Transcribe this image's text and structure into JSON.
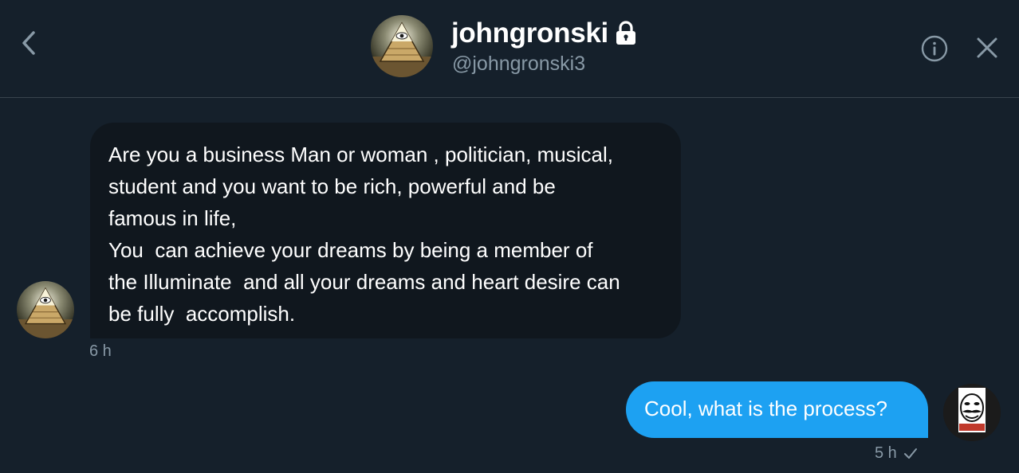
{
  "header": {
    "display_name": "johngronski",
    "handle": "@johngronski3",
    "icons": {
      "back": "chevron-left-icon",
      "lock": "lock-icon",
      "info": "info-icon",
      "close": "close-icon"
    }
  },
  "messages": [
    {
      "from": "them",
      "text": "Are you a business Man or woman , politician, musical,\nstudent and you want to be rich, powerful and be\nfamous in life,\nYou  can achieve your dreams by being a member of\nthe Illuminate  and all your dreams and heart desire can\nbe fully  accomplish.",
      "time": "6 h"
    },
    {
      "from": "me",
      "text": "Cool, what is the process?",
      "time": "5 h",
      "status_icon": "checkmark-icon"
    }
  ],
  "colors": {
    "background": "#15202b",
    "divider": "#38444d",
    "their_bubble": "#10171e",
    "my_bubble": "#1da1f2",
    "secondary_text": "#8899a6"
  }
}
